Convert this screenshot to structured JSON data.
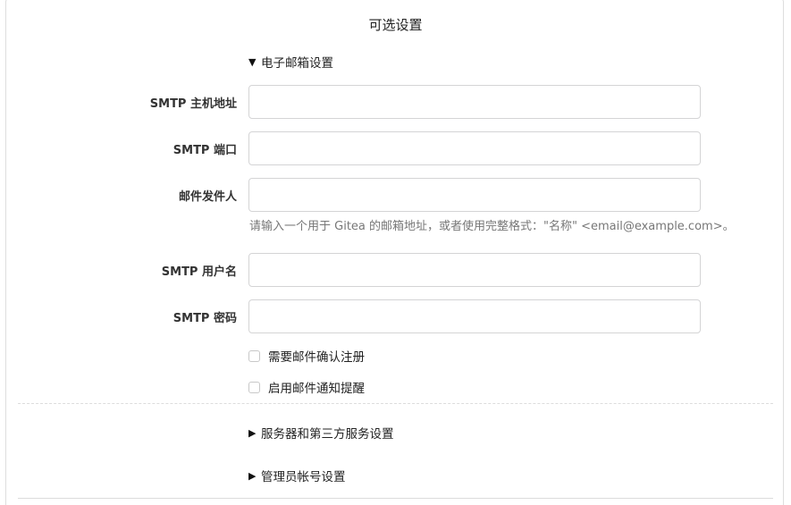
{
  "section": {
    "title": "可选设置"
  },
  "email": {
    "summary": "电子邮箱设置",
    "caret": "▼",
    "fields": {
      "smtp_host": {
        "label": "SMTP 主机地址",
        "value": ""
      },
      "smtp_port": {
        "label": "SMTP 端口",
        "value": ""
      },
      "from": {
        "label": "邮件发件人",
        "value": ""
      },
      "smtp_user": {
        "label": "SMTP 用户名",
        "value": ""
      },
      "smtp_password": {
        "label": "SMTP 密码",
        "value": ""
      }
    },
    "from_help": "请输入一个用于 Gitea 的邮箱地址，或者使用完整格式：\"名称\" <email@example.com>。",
    "checkboxes": {
      "register_confirm": {
        "label": "需要邮件确认注册",
        "checked": false
      },
      "mail_notify": {
        "label": "启用邮件通知提醒",
        "checked": false
      }
    }
  },
  "server": {
    "summary": "服务器和第三方服务设置",
    "caret": "▶"
  },
  "admin": {
    "summary": "管理员帐号设置",
    "caret": "▶"
  }
}
